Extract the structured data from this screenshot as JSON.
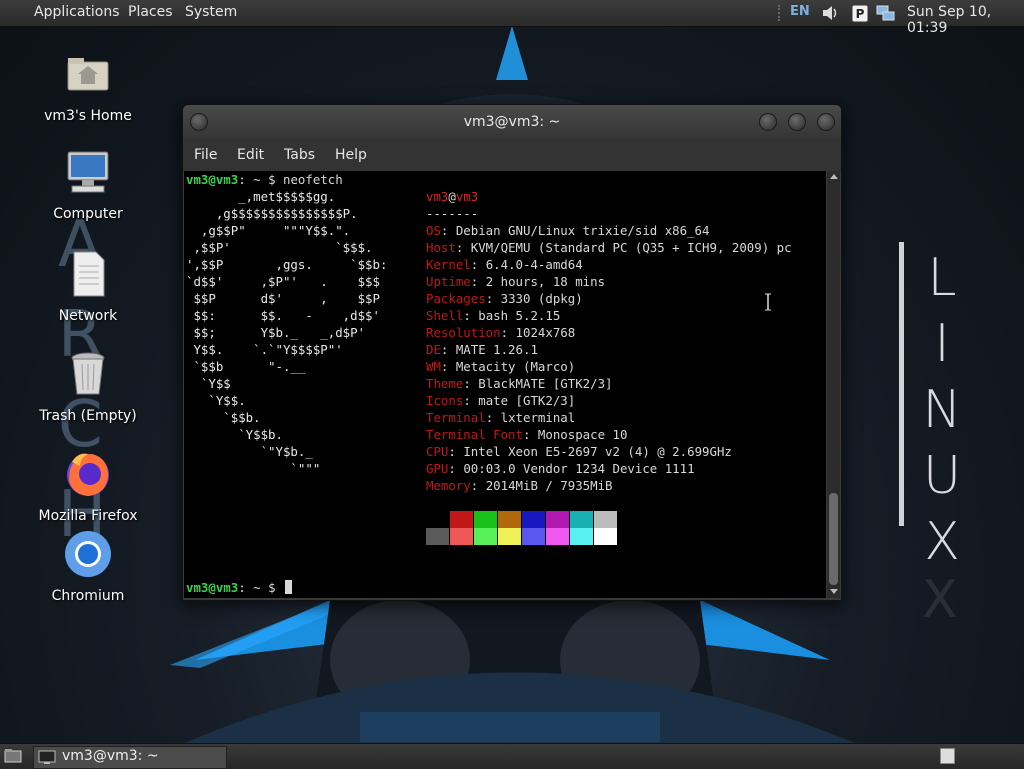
{
  "top_panel": {
    "menus": [
      "Applications",
      "Places",
      "System"
    ],
    "language": "EN",
    "clock": "Sun Sep 10, 01:39"
  },
  "background": {
    "arch_letters": [
      "A",
      "R",
      "C",
      "H"
    ],
    "linux_letters": [
      "L",
      "I",
      "N",
      "U",
      "X"
    ],
    "linux_reflection": "X"
  },
  "desktop_icons": [
    {
      "label": "vm3's Home",
      "icon": "home-folder-icon"
    },
    {
      "label": "Computer",
      "icon": "computer-icon"
    },
    {
      "label": "Network",
      "icon": "network-icon"
    },
    {
      "label": "Trash (Empty)",
      "icon": "trash-icon"
    },
    {
      "label": "Mozilla Firefox",
      "icon": "firefox-icon"
    },
    {
      "label": "Chromium",
      "icon": "chromium-icon"
    }
  ],
  "terminal": {
    "title": "vm3@vm3: ~",
    "menus": [
      "File",
      "Edit",
      "Tabs",
      "Help"
    ],
    "prompt": "vm3@vm3",
    "prompt_suffix": ": ~",
    "command": "neofetch",
    "dollar": "$",
    "logo_lines": [
      "       _,met$$$$$gg.",
      "    ,g$$$$$$$$$$$$$$$P.",
      "  ,g$$P\"     \"\"\"Y$$.\".",
      " ,$$P'              `$$$.",
      "',$$P       ,ggs.     `$$b:",
      "`d$$'     ,$P\"'   .    $$$",
      " $$P      d$'     ,    $$P",
      " $$:      $$.   -    ,d$$'",
      " $$;      Y$b._   _,d$P'",
      " Y$$.    `.`\"Y$$$$P\"'",
      " `$$b      \"-.__",
      "  `Y$$",
      "   `Y$$.",
      "     `$$b.",
      "       `Y$$b.",
      "          `\"Y$b._",
      "              `\"\"\""
    ],
    "user_host": {
      "user": "vm3",
      "at": "@",
      "host": "vm3"
    },
    "separator": "-------",
    "info": [
      {
        "label": "OS",
        "value": "Debian GNU/Linux trixie/sid x86_64"
      },
      {
        "label": "Host",
        "value": "KVM/QEMU (Standard PC (Q35 + ICH9, 2009) pc"
      },
      {
        "label": "Kernel",
        "value": "6.4.0-4-amd64"
      },
      {
        "label": "Uptime",
        "value": "2 hours, 18 mins"
      },
      {
        "label": "Packages",
        "value": "3330 (dpkg)"
      },
      {
        "label": "Shell",
        "value": "bash 5.2.15"
      },
      {
        "label": "Resolution",
        "value": "1024x768"
      },
      {
        "label": "DE",
        "value": "MATE 1.26.1"
      },
      {
        "label": "WM",
        "value": "Metacity (Marco)"
      },
      {
        "label": "Theme",
        "value": "BlackMATE [GTK2/3]"
      },
      {
        "label": "Icons",
        "value": "mate [GTK2/3]"
      },
      {
        "label": "Terminal",
        "value": "lxterminal"
      },
      {
        "label": "Terminal Font",
        "value": "Monospace 10"
      },
      {
        "label": "CPU",
        "value": "Intel Xeon E5-2697 v2 (4) @ 2.699GHz"
      },
      {
        "label": "GPU",
        "value": "00:03.0 Vendor 1234 Device 1111"
      },
      {
        "label": "Memory",
        "value": "2014MiB / 7935MiB"
      }
    ],
    "palette_row1": [
      "#000000",
      "#c01818",
      "#18c018",
      "#b0680c",
      "#1818c0",
      "#b018b0",
      "#18b0b0",
      "#bcbcbc"
    ],
    "palette_row2": [
      "#5a5a5a",
      "#f05858",
      "#58f058",
      "#f0f058",
      "#5858f0",
      "#f058f0",
      "#58f0f0",
      "#ffffff"
    ]
  },
  "taskbar": {
    "window_label": "vm3@vm3: ~"
  },
  "colors": {
    "prompt_green": "#36d44a",
    "label_red": "#c01818",
    "panel": "#2f2f2f"
  }
}
